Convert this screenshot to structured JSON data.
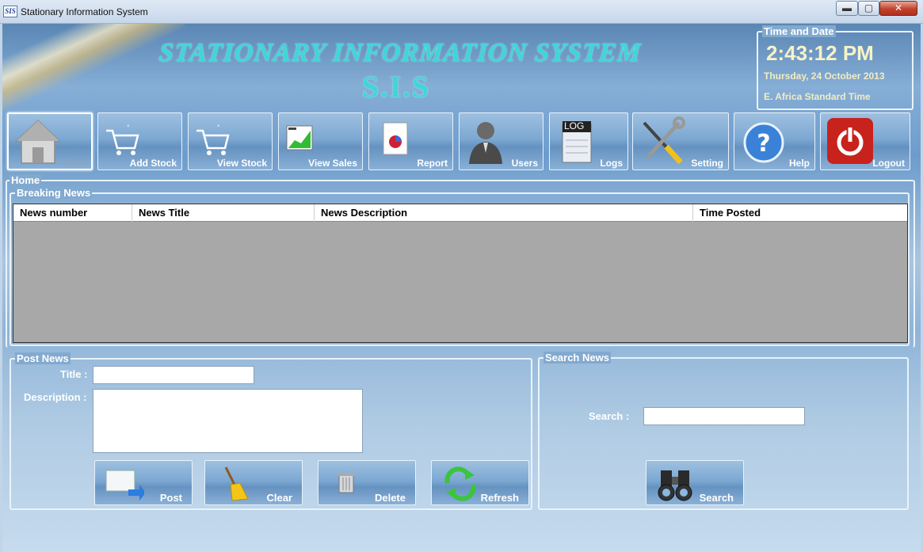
{
  "window": {
    "icon_text": "SIS",
    "title": "Stationary Information System",
    "min_label": "▬",
    "max_label": "▢",
    "close_label": "✕"
  },
  "header": {
    "title": "STATIONARY INFORMATION SYSTEM",
    "abbr": "S.I.S"
  },
  "time_box": {
    "title": "Time and Date",
    "clock": "2:43:12 PM",
    "date": "Thursday, 24 October 2013",
    "timezone": "E. Africa Standard Time"
  },
  "toolbar": {
    "home": "Home",
    "add_stock": "Add Stock",
    "view_stock": "View Stock",
    "view_sales": "View Sales",
    "report": "Report",
    "users": "Users",
    "logs": "Logs",
    "setting": "Setting",
    "help": "Help",
    "logout": "Logout",
    "logs_icon_text": "LOG"
  },
  "home_group": {
    "title": "Home"
  },
  "news_group": {
    "title": "Breaking News",
    "columns": [
      "News number",
      "News Title",
      "News Description",
      "Time Posted"
    ]
  },
  "post_news": {
    "title": "Post News",
    "title_label": "Title :",
    "description_label": "Description :",
    "title_value": "",
    "description_value": "",
    "buttons": {
      "post": "Post",
      "clear": "Clear",
      "delete": "Delete",
      "refresh": "Refresh"
    }
  },
  "search_news": {
    "title": "Search News",
    "search_label": "Search  :",
    "search_value": "",
    "button": "Search"
  }
}
